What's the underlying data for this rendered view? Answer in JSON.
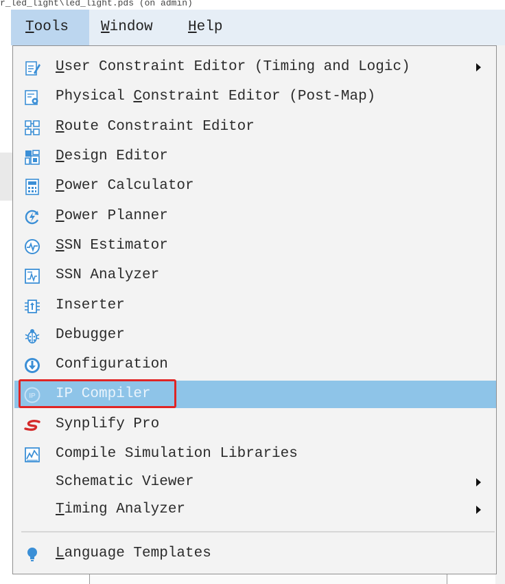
{
  "window": {
    "title_fragment": "r_led_light\\led_light.pds (on admin)"
  },
  "menubar": {
    "items": [
      {
        "label": "Tools",
        "mnemonic": "T",
        "rest": "ools",
        "active": true
      },
      {
        "label": "Window",
        "mnemonic": "W",
        "rest": "indow",
        "active": false
      },
      {
        "label": "Help",
        "mnemonic": "H",
        "rest": "elp",
        "active": false
      }
    ]
  },
  "tools_menu": {
    "items": [
      {
        "pre": "",
        "mn": "U",
        "post": "ser Constraint Editor (Timing and Logic)",
        "icon": "edit-doc-icon",
        "submenu": true
      },
      {
        "pre": "Physical ",
        "mn": "C",
        "post": "onstraint Editor (Post-Map)",
        "icon": "doc-gear-icon",
        "submenu": false
      },
      {
        "pre": "",
        "mn": "R",
        "post": "oute Constraint Editor",
        "icon": "route-grid-icon",
        "submenu": false
      },
      {
        "pre": "",
        "mn": "D",
        "post": "esign Editor",
        "icon": "design-editor-icon",
        "submenu": false
      },
      {
        "pre": "",
        "mn": "P",
        "post": "ower Calculator",
        "icon": "calculator-icon",
        "submenu": false
      },
      {
        "pre": "",
        "mn": "P",
        "post": "ower Planner",
        "icon": "power-planner-icon",
        "submenu": false
      },
      {
        "pre": "",
        "mn": "S",
        "post": "SN Estimator",
        "icon": "waveform-circle-icon",
        "submenu": false
      },
      {
        "pre": "SSN Analyzer",
        "mn": "",
        "post": "",
        "icon": "chart-analyzer-icon",
        "submenu": false
      },
      {
        "pre": "Inserter",
        "mn": "",
        "post": "",
        "icon": "inserter-icon",
        "submenu": false
      },
      {
        "pre": "Debugger",
        "mn": "",
        "post": "",
        "icon": "bug-icon",
        "submenu": false
      },
      {
        "pre": "Configuration",
        "mn": "",
        "post": "",
        "icon": "download-circle-icon",
        "submenu": false
      },
      {
        "pre": "IP Compiler",
        "mn": "",
        "post": "",
        "icon": "ip-icon",
        "submenu": false,
        "selected": true
      },
      {
        "pre": "Synplify Pro",
        "mn": "",
        "post": "",
        "icon": "synplify-logo-icon",
        "submenu": false
      },
      {
        "pre": "Compile Simulation Libraries",
        "mn": "",
        "post": "",
        "icon": "simulation-chart-icon",
        "submenu": false
      },
      {
        "pre": "Schematic Viewer",
        "mn": "",
        "post": "",
        "icon": "",
        "submenu": true
      },
      {
        "pre": "",
        "mn": "T",
        "post": "iming Analyzer",
        "icon": "",
        "submenu": true
      },
      {
        "pre": "",
        "mn": "L",
        "post": "anguage Templates",
        "icon": "lightbulb-icon",
        "submenu": false
      }
    ]
  },
  "colors": {
    "menubar_bg": "#e6eef6",
    "active_menu_bg": "#bcd6ef",
    "selected_item_bg": "#8ec4e8",
    "highlight_border": "#e02424",
    "icon_blue": "#3b8fd6"
  }
}
